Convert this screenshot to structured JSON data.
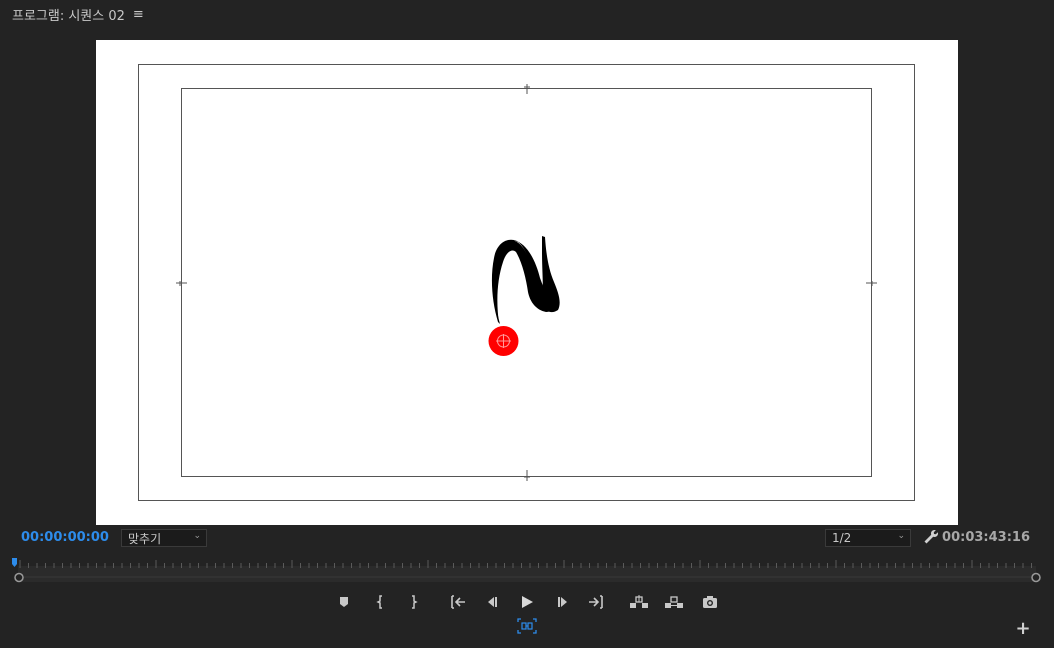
{
  "panel": {
    "title": "프로그램: 시퀀스 02",
    "menu_icon": "hamburger-icon"
  },
  "monitor": {
    "background_color": "#ffffff",
    "guide_color": "#555555",
    "cursor_marker_color": "#ff0000",
    "content": "brush-stroke-image"
  },
  "controls": {
    "current_time": "00:00:00:00",
    "zoom_level": "맞추기",
    "resolution": "1/2",
    "duration": "00:03:43:16",
    "accent_color": "#2d8ceb"
  },
  "scrubber": {
    "playhead_position": 0.0
  },
  "transport": {
    "buttons": [
      "add-marker-icon",
      "mark-in-icon",
      "mark-out-icon",
      "go-to-in-icon",
      "step-back-icon",
      "play-icon",
      "step-forward-icon",
      "go-to-out-icon",
      "lift-icon",
      "extract-icon",
      "export-frame-icon"
    ],
    "secondary": [
      "comparison-view-icon"
    ],
    "button_editor_icon": "plus-icon"
  }
}
